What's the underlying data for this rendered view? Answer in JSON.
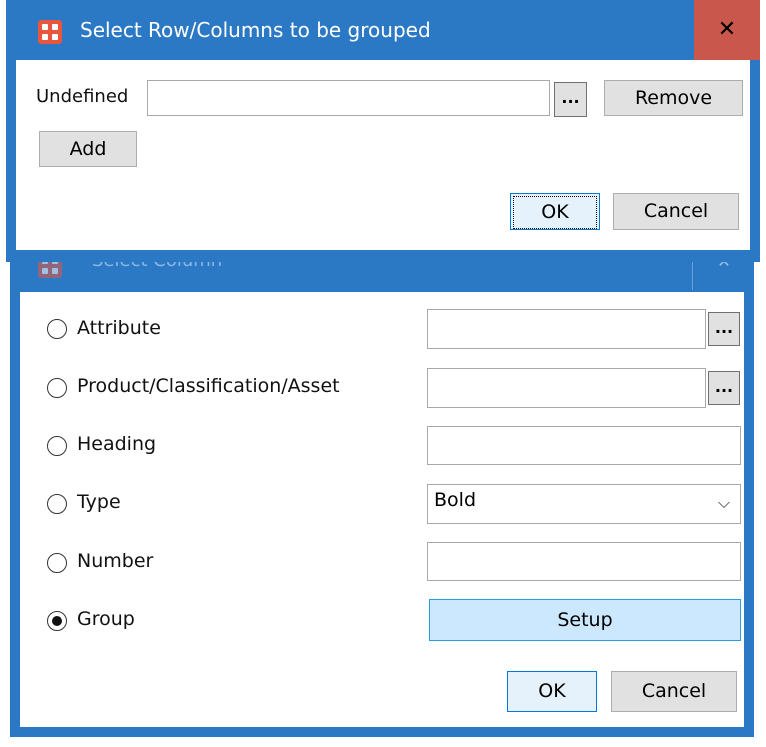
{
  "select_column": {
    "title": "Select Column",
    "close_glyph": "✕",
    "rows": [
      {
        "label": "Attribute",
        "checked": false
      },
      {
        "label": "Product/Classification/Asset",
        "checked": false
      },
      {
        "label": "Heading",
        "checked": false
      },
      {
        "label": "Type",
        "checked": false
      },
      {
        "label": "Number",
        "checked": false
      },
      {
        "label": "Group",
        "checked": true
      }
    ],
    "browse_label": "...",
    "type_value": "Bold",
    "setup_label": "Setup",
    "ok_label": "OK",
    "cancel_label": "Cancel"
  },
  "group_dialog": {
    "title": "Select Row/Columns to be grouped",
    "close_glyph": "✕",
    "undefined_label": "Undefined",
    "undefined_value": "",
    "browse_label": "...",
    "remove_label": "Remove",
    "add_label": "Add",
    "ok_label": "OK",
    "cancel_label": "Cancel"
  },
  "colors": {
    "title_bar": "#2b78c5",
    "close_red": "#c9574c",
    "app_icon": "#e8563e",
    "setup_button": "#cce8ff"
  },
  "icons": {
    "app": "app-grid-icon",
    "close": "close-icon",
    "dropdown": "chevron-down-icon"
  }
}
